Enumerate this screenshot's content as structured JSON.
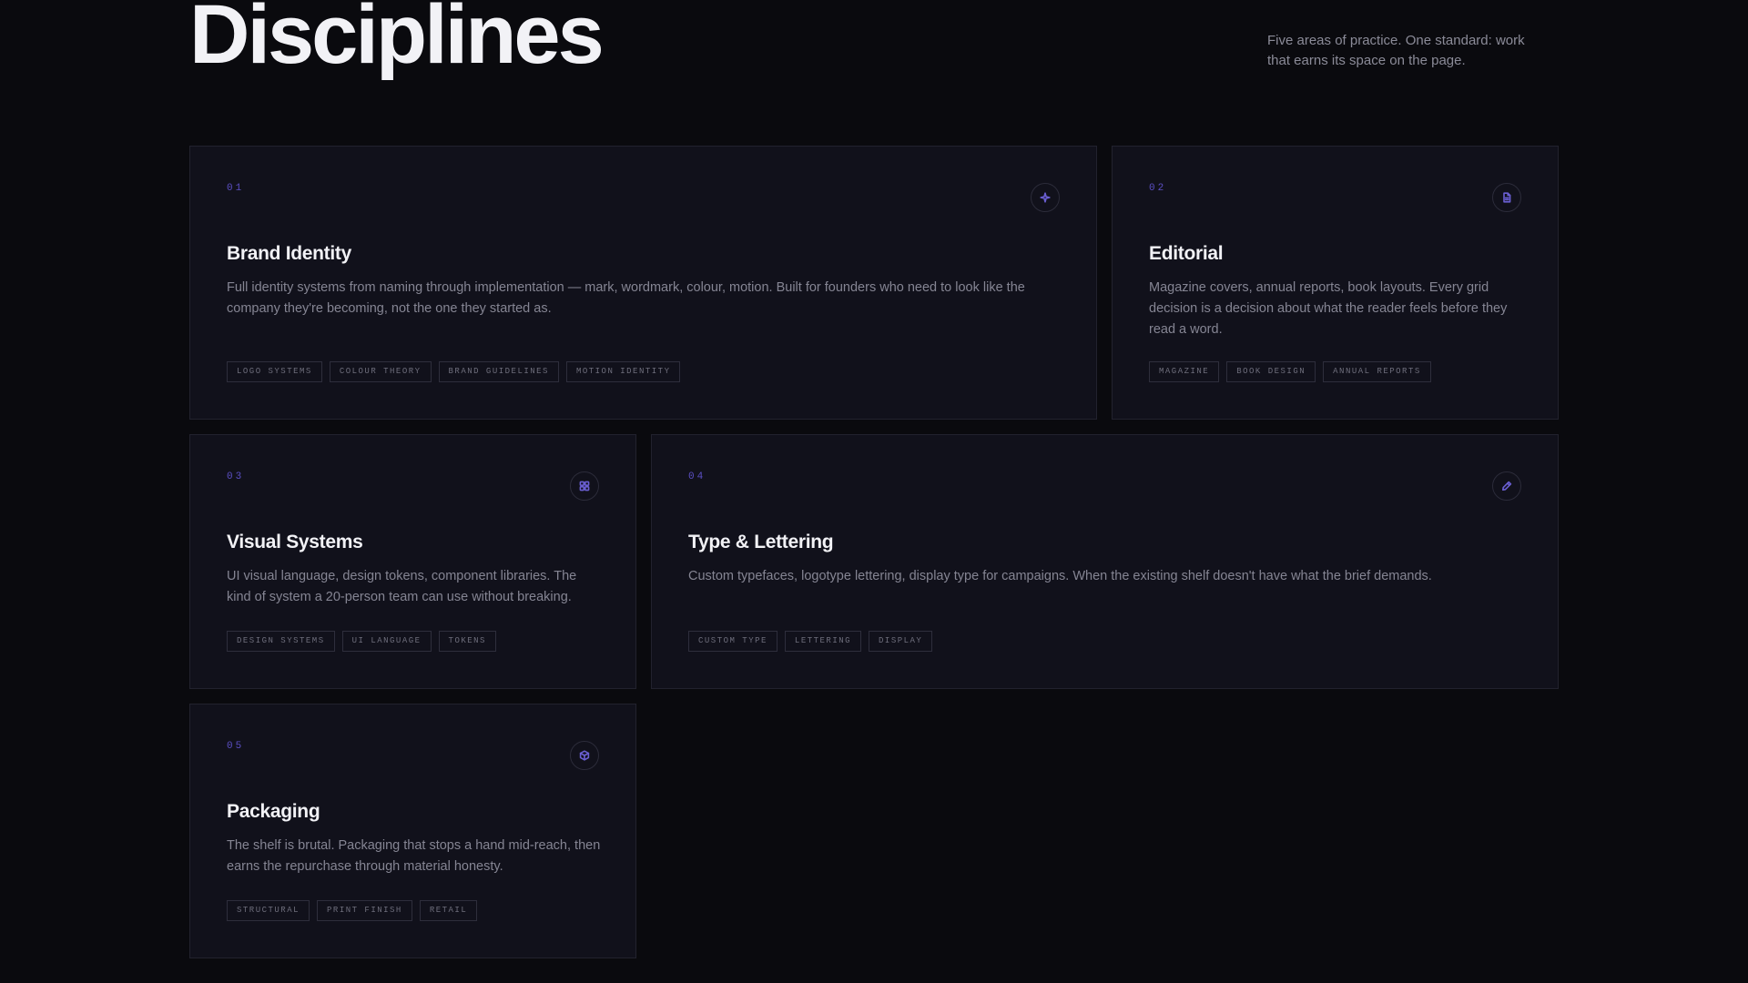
{
  "header": {
    "title": "Disciplines",
    "intro": "Five areas of practice. One standard: work that earns its space on the page."
  },
  "accent_color": "#5b4fc4",
  "cards": [
    {
      "number": "01",
      "icon": "sparkle-icon",
      "title": "Brand Identity",
      "description": "Full identity systems from naming through implementation — mark, wordmark, colour, motion. Built for founders who need to look like the company they're becoming, not the one they started as.",
      "tags": [
        "LOGO SYSTEMS",
        "COLOUR THEORY",
        "BRAND GUIDELINES",
        "MOTION IDENTITY"
      ]
    },
    {
      "number": "02",
      "icon": "document-icon",
      "title": "Editorial",
      "description": "Magazine covers, annual reports, book layouts. Every grid decision is a decision about what the reader feels before they read a word.",
      "tags": [
        "MAGAZINE",
        "BOOK DESIGN",
        "ANNUAL REPORTS"
      ]
    },
    {
      "number": "03",
      "icon": "grid-icon",
      "title": "Visual Systems",
      "description": "UI visual language, design tokens, component libraries. The kind of system a 20-person team can use without breaking.",
      "tags": [
        "DESIGN SYSTEMS",
        "UI LANGUAGE",
        "TOKENS"
      ]
    },
    {
      "number": "04",
      "icon": "pen-icon",
      "title": "Type & Lettering",
      "description": "Custom typefaces, logotype lettering, display type for campaigns. When the existing shelf doesn't have what the brief demands.",
      "tags": [
        "CUSTOM TYPE",
        "LETTERING",
        "DISPLAY"
      ]
    },
    {
      "number": "05",
      "icon": "box-icon",
      "title": "Packaging",
      "description": "The shelf is brutal. Packaging that stops a hand mid-reach, then earns the repurchase through material honesty.",
      "tags": [
        "STRUCTURAL",
        "PRINT FINISH",
        "RETAIL"
      ]
    }
  ]
}
